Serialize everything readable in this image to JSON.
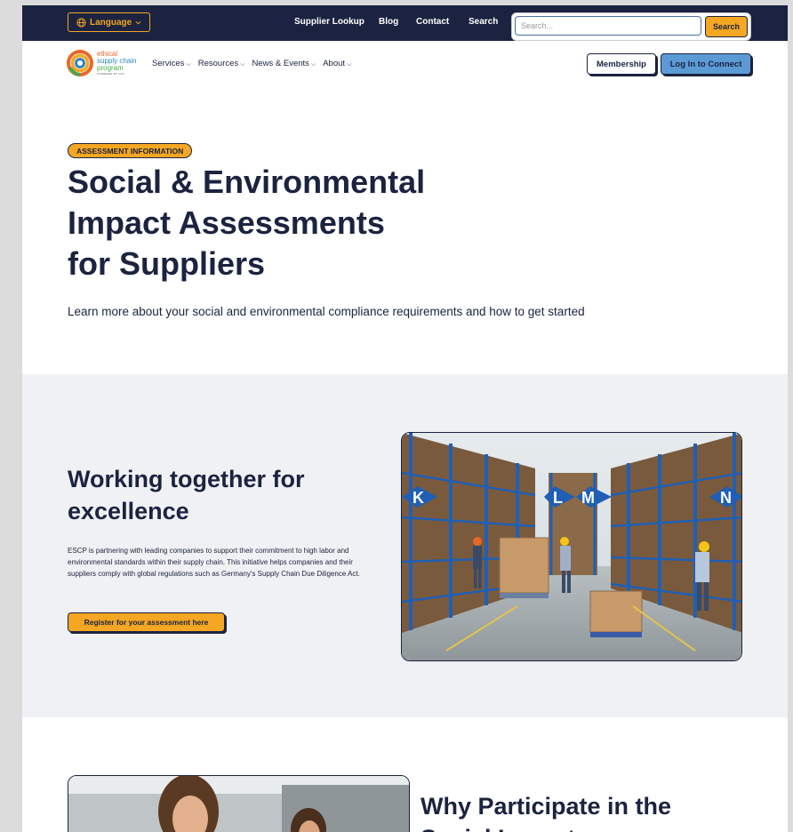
{
  "topbar": {
    "language_label": "Language",
    "links": [
      "Supplier Lookup",
      "Blog",
      "Contact",
      "Search"
    ],
    "search_placeholder": "Search...",
    "search_button": "Search"
  },
  "nav": {
    "logo": {
      "line1": "ethical",
      "line2": "supply chain",
      "line3": "program",
      "line4": "POWERED BY ICTI"
    },
    "menu": [
      "Services",
      "Resources",
      "News & Events",
      "About"
    ],
    "membership": "Membership",
    "login": "Log In to Connect"
  },
  "hero": {
    "badge": "ASSESSMENT INFORMATION",
    "title_line1": "Social & Environmental",
    "title_line2": "Impact Assessments",
    "title_line3": "for Suppliers",
    "subtitle": "Learn more about your social and environmental compliance requirements and how to get started"
  },
  "section2": {
    "title_line1": "Working together for",
    "title_line2": "excellence",
    "text": "ESCP is partnering with leading companies to support their commitment to high labor and environmental standards within their supply chain. This initiative helps companies and their suppliers comply with global regulations such as Germany's Supply Chain Due Diligence Act.",
    "button": "Register for your assessment here",
    "aisle_signs": [
      "K",
      "L",
      "M",
      "N"
    ]
  },
  "section3": {
    "title_line1": "Why Participate in the",
    "title_line2": "Social Impact"
  },
  "colors": {
    "navy": "#1b2340",
    "orange": "#f5a623",
    "blue": "#5b9bd5",
    "section_bg": "#f0f1f4"
  }
}
